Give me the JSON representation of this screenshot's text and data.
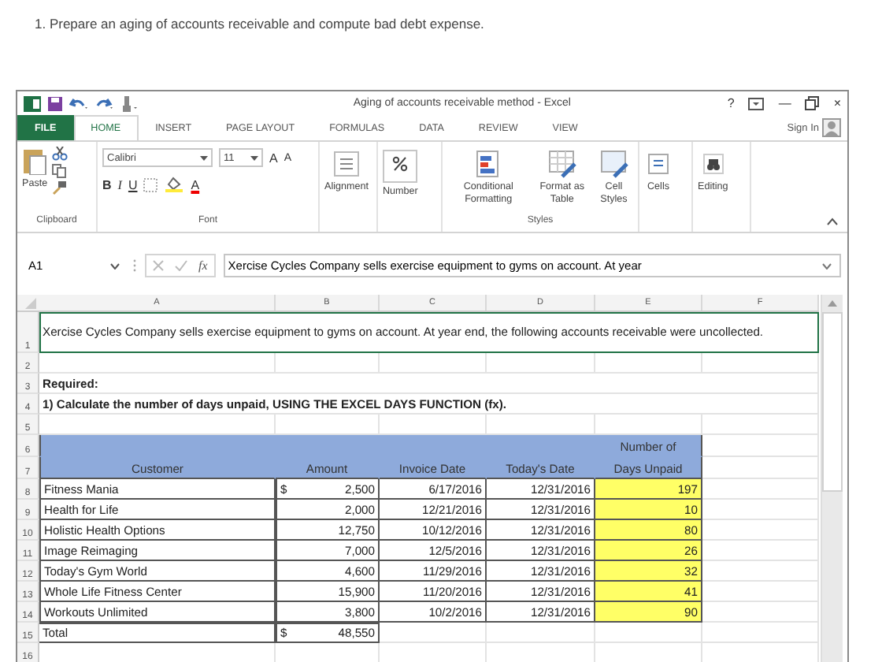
{
  "question": "1. Prepare an aging of accounts receivable and compute bad debt expense.",
  "window": {
    "title": "Aging of accounts receivable method - Excel",
    "controls": [
      "?",
      "—",
      "×"
    ]
  },
  "tabs": [
    {
      "label": "FILE",
      "kind": "file",
      "selected": false
    },
    {
      "label": "HOME",
      "kind": "tab",
      "selected": true
    },
    {
      "label": "INSERT",
      "kind": "tab",
      "selected": false
    },
    {
      "label": "PAGE LAYOUT",
      "kind": "tab",
      "selected": false
    },
    {
      "label": "FORMULAS",
      "kind": "tab",
      "selected": false
    },
    {
      "label": "DATA",
      "kind": "tab",
      "selected": false
    },
    {
      "label": "REVIEW",
      "kind": "tab",
      "selected": false
    },
    {
      "label": "VIEW",
      "kind": "tab",
      "selected": false
    }
  ],
  "sign_in": "Sign In",
  "ribbon": {
    "paste": "Paste",
    "font_name": "Calibri",
    "font_size": "11",
    "grow": "A",
    "shrink": "A",
    "bold": "B",
    "italic": "I",
    "underline": "U",
    "font_color": "A",
    "alignment": "Alignment",
    "number": "Number",
    "conditional": "Conditional Formatting",
    "format_table": "Format as Table",
    "cell_styles": "Cell Styles",
    "cells": "Cells",
    "editing": "Editing",
    "groups": [
      "Clipboard",
      "Font",
      "Styles"
    ]
  },
  "formula_bar": {
    "name_box": "A1",
    "fx": "fx",
    "value": "Xercise Cycles Company sells exercise equipment to gyms on account.  At year"
  },
  "sheet": {
    "columns": [
      "A",
      "B",
      "C",
      "D",
      "E",
      "F"
    ],
    "rows": [
      {
        "number": "1",
        "kind": "note",
        "selected": true,
        "text": "Xercise Cycles Company sells exercise equipment to gyms on account.  At year end, the following accounts receivable were uncollected."
      },
      {
        "number": "2",
        "kind": "blank",
        "selected": false
      },
      {
        "number": "3",
        "kind": "heading",
        "selected": false,
        "text": "Required:"
      },
      {
        "number": "4",
        "kind": "heading",
        "selected": false,
        "text": "1) Calculate the number of days unpaid, USING THE EXCEL DAYS FUNCTION (fx)."
      },
      {
        "number": "5",
        "kind": "blank",
        "selected": false
      },
      {
        "number": "6",
        "kind": "header",
        "selected": false,
        "cells": [
          null,
          null,
          null,
          null,
          "Number of"
        ]
      },
      {
        "number": "7",
        "kind": "header",
        "selected": false,
        "cells": [
          "Customer",
          "Amount",
          "Invoice Date",
          "Today's Date",
          "Days Unpaid"
        ]
      },
      {
        "number": "8",
        "kind": "data",
        "selected": false,
        "customer": "Fitness Mania",
        "currency": "$",
        "amount": "2,500",
        "invoice_date": "6/17/2016",
        "today": "12/31/2016",
        "days": "197"
      },
      {
        "number": "9",
        "kind": "data",
        "selected": false,
        "customer": "Health for Life",
        "amount": "2,000",
        "invoice_date": "12/21/2016",
        "today": "12/31/2016",
        "days": "10"
      },
      {
        "number": "10",
        "kind": "data",
        "selected": false,
        "customer": "Holistic Health Options",
        "amount": "12,750",
        "invoice_date": "10/12/2016",
        "today": "12/31/2016",
        "days": "80"
      },
      {
        "number": "11",
        "kind": "data",
        "selected": false,
        "customer": "Image Reimaging",
        "amount": "7,000",
        "invoice_date": "12/5/2016",
        "today": "12/31/2016",
        "days": "26"
      },
      {
        "number": "12",
        "kind": "data",
        "selected": false,
        "customer": "Today's Gym World",
        "amount": "4,600",
        "invoice_date": "11/29/2016",
        "today": "12/31/2016",
        "days": "32"
      },
      {
        "number": "13",
        "kind": "data",
        "selected": false,
        "customer": "Whole Life Fitness Center",
        "amount": "15,900",
        "invoice_date": "11/20/2016",
        "today": "12/31/2016",
        "days": "41"
      },
      {
        "number": "14",
        "kind": "data",
        "selected": false,
        "customer": "Workouts Unlimited",
        "amount": "3,800",
        "invoice_date": "10/2/2016",
        "today": "12/31/2016",
        "days": "90"
      },
      {
        "number": "15",
        "kind": "total",
        "selected": false,
        "label": "Total",
        "currency": "$",
        "amount": "48,550"
      },
      {
        "number": "16",
        "kind": "blank",
        "selected": false
      }
    ]
  }
}
